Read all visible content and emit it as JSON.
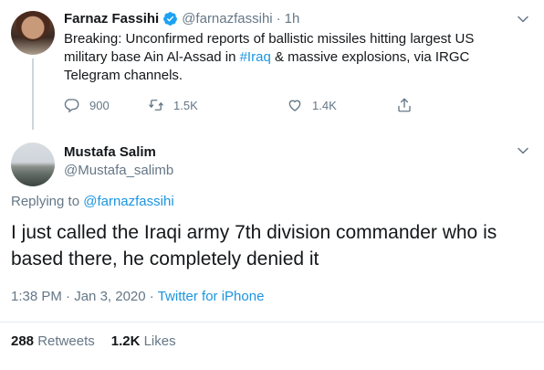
{
  "parent_tweet": {
    "author_name": "Farnaz Fassihi",
    "author_handle": "@farnazfassihi",
    "separator": "·",
    "time": "1h",
    "text_before_hashtag": "Breaking: Unconfirmed reports of ballistic missiles hitting largest US military base Ain Al-Assad in ",
    "hashtag": "#Iraq",
    "text_after_hashtag": " & massive explosions, via IRGC Telegram channels.",
    "replies": "900",
    "retweets": "1.5K",
    "likes": "1.4K"
  },
  "reply_tweet": {
    "author_name": "Mustafa Salim",
    "author_handle": "@Mustafa_salimb",
    "replying_prefix": "Replying to",
    "replying_to": "@farnazfassihi",
    "text": "I just called the Iraqi army 7th division commander who is based there, he completely denied it",
    "time": "1:38 PM",
    "dot1": "·",
    "date": "Jan 3, 2020",
    "dot2": "·",
    "source": "Twitter for iPhone",
    "retweets_count": "288",
    "retweets_label": "Retweets",
    "likes_count": "1.2K",
    "likes_label": "Likes"
  },
  "colors": {
    "link": "#1b95e0",
    "muted": "#657786",
    "text": "#14171a",
    "verified": "#1da1f2"
  },
  "icons": [
    "verified-badge-icon",
    "chevron-down-icon",
    "reply-icon",
    "retweet-icon",
    "like-heart-icon",
    "share-icon"
  ]
}
